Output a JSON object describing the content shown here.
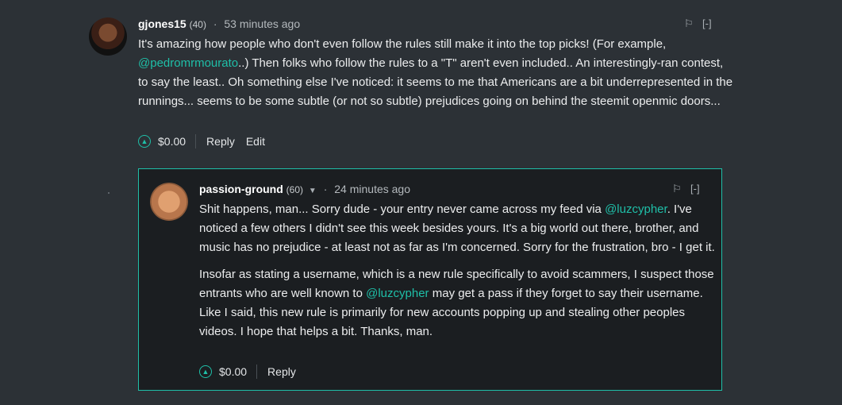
{
  "comment1": {
    "author": "gjones15",
    "reputation": "(40)",
    "separator": "·",
    "time": "53 minutes ago",
    "flag_icon": "flag-icon",
    "collapse_label": "[-]",
    "text": {
      "part1": "It's amazing how people who don't even follow the rules still make it into the top picks! (For example, ",
      "mention": "@pedromrmourato",
      "part2": "..) Then folks who follow the rules to a \"T\" aren't even included.. An interestingly-ran contest, to say the least.. Oh something else I've noticed: it seems to me that Americans are a bit underrepresented in the runnings... seems to be some subtle (or not so subtle) prejudices going on behind the steemit openmic doors..."
    },
    "payout": "$0.00",
    "reply_label": "Reply",
    "edit_label": "Edit"
  },
  "comment2": {
    "author": "passion-ground",
    "reputation": "(60)",
    "separator": "·",
    "time": "24 minutes ago",
    "flag_icon": "flag-icon",
    "collapse_label": "[-]",
    "paragraph1": {
      "part1": "Shit happens, man... Sorry dude - your entry never came across my feed via ",
      "mention": "@luzcypher",
      "part2": ". I've noticed a few others I didn't see this week besides yours. It's a big world out there, brother, and music has no prejudice - at least not as far as I'm concerned. Sorry for the frustration, bro - I get it."
    },
    "paragraph2": {
      "part1": "Insofar as stating a username, which is a new rule specifically to avoid scammers, I suspect those entrants who are well known to ",
      "mention": "@luzcypher",
      "part2": " may get a pass if they forget to say their username. Like I said, this new rule is primarily for new accounts popping up and stealing other peoples videos. I hope that helps a bit. Thanks, man."
    },
    "payout": "$0.00",
    "reply_label": "Reply"
  },
  "colors": {
    "background": "#2c3136",
    "reply_background": "#1b1e21",
    "accent": "#1fbfa8",
    "text": "#ecedee"
  }
}
